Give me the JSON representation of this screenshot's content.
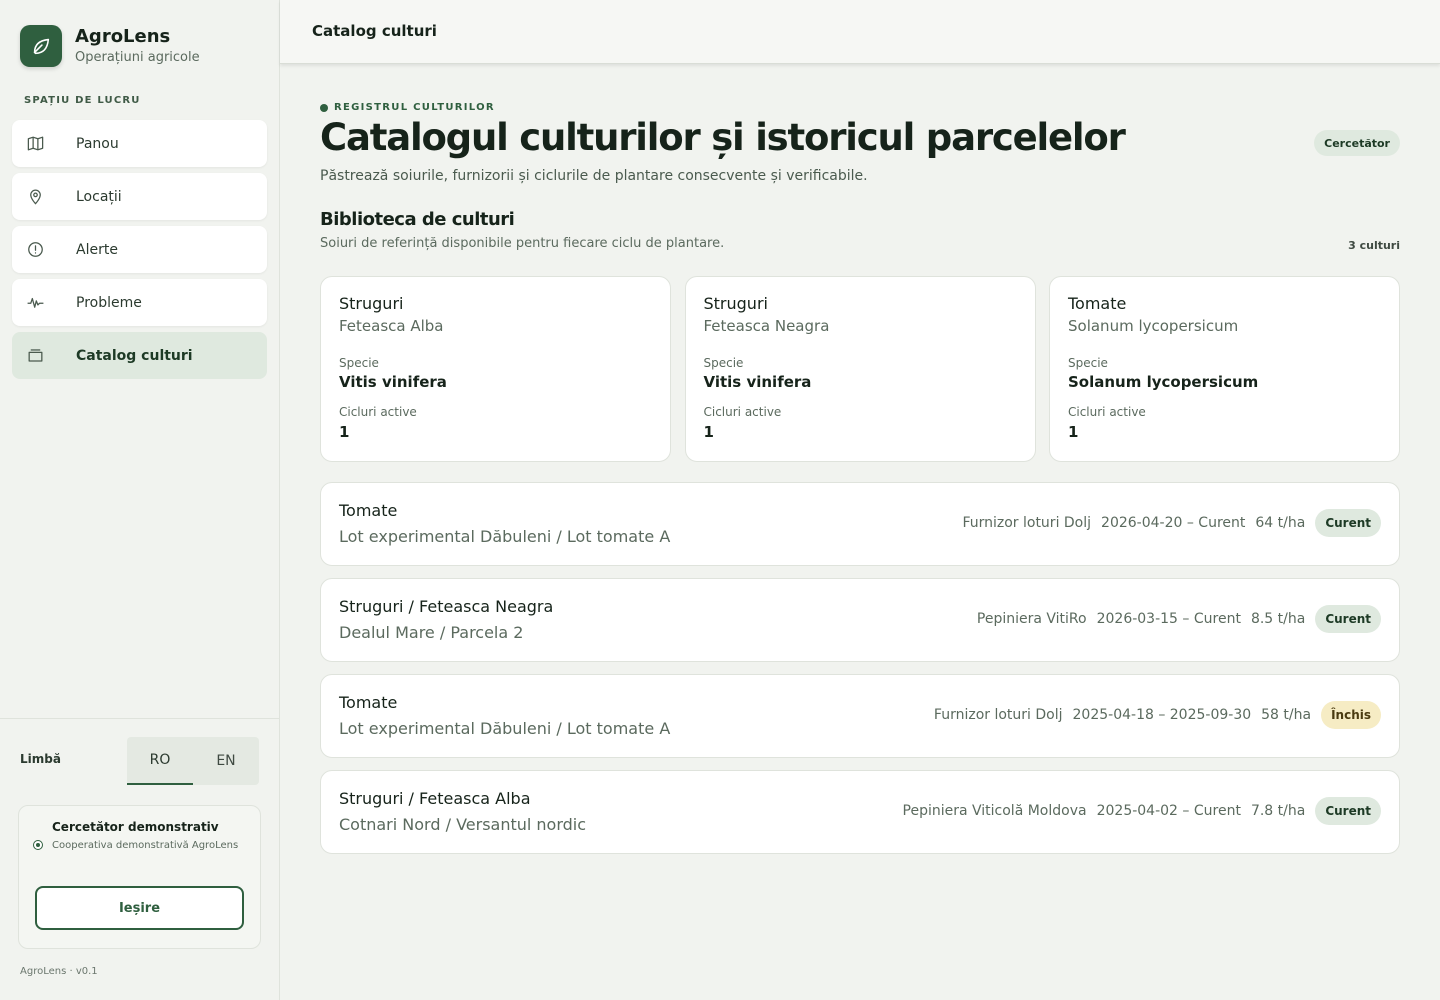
{
  "brand": {
    "name": "AgroLens",
    "subtitle": "Operațiuni agricole"
  },
  "sidebar": {
    "section_label": "SPAȚIU DE LUCRU",
    "items": [
      {
        "label": "Panou",
        "icon": "map-icon"
      },
      {
        "label": "Locații",
        "icon": "location-pin-icon"
      },
      {
        "label": "Alerte",
        "icon": "alert-circle-icon"
      },
      {
        "label": "Probleme",
        "icon": "activity-icon"
      },
      {
        "label": "Catalog culturi",
        "icon": "archive-box-icon",
        "active": true
      }
    ],
    "language": {
      "label": "Limbă",
      "options": [
        "RO",
        "EN"
      ],
      "selected": "RO"
    },
    "user": {
      "name": "Cercetător demonstrativ",
      "org": "Cooperativa demonstrativă AgroLens",
      "logout_label": "Ieșire"
    },
    "version": "AgroLens · v0.1"
  },
  "topbar": {
    "title": "Catalog culturi"
  },
  "header": {
    "eyebrow": "REGISTRUL CULTURILOR",
    "title": "Catalogul culturilor și istoricul parcelelor",
    "subtitle": "Păstrează soiurile, furnizorii și ciclurile de plantare consecvente și verificabile.",
    "role_badge": "Cercetător"
  },
  "library": {
    "title": "Biblioteca de culturi",
    "subtitle": "Soiuri de referință disponibile pentru fiecare ciclu de plantare.",
    "count": "3 culturi",
    "species_label": "Specie",
    "cycles_label": "Cicluri active",
    "crops": [
      {
        "name": "Struguri",
        "variety": "Feteasca Alba",
        "species": "Vitis vinifera",
        "active_cycles": "1"
      },
      {
        "name": "Struguri",
        "variety": "Feteasca Neagra",
        "species": "Vitis vinifera",
        "active_cycles": "1"
      },
      {
        "name": "Tomate",
        "variety": "Solanum lycopersicum",
        "species": "Solanum lycopersicum",
        "active_cycles": "1"
      }
    ]
  },
  "cycles": [
    {
      "title": "Tomate",
      "location": "Lot experimental Dăbuleni / Lot tomate A",
      "supplier": "Furnizor loturi Dolj",
      "period": "2026-04-20 – Curent",
      "yield": "64 t/ha",
      "status": "Curent",
      "status_color": "#dfe9df"
    },
    {
      "title": "Struguri / Feteasca Neagra",
      "location": "Dealul Mare / Parcela 2",
      "supplier": "Pepiniera VitiRo",
      "period": "2026-03-15 – Curent",
      "yield": "8.5 t/ha",
      "status": "Curent",
      "status_color": "#dfe9df"
    },
    {
      "title": "Tomate",
      "location": "Lot experimental Dăbuleni / Lot tomate A",
      "supplier": "Furnizor loturi Dolj",
      "period": "2025-04-18 – 2025-09-30",
      "yield": "58 t/ha",
      "status": "Închis",
      "status_color": "#f6ecc4"
    },
    {
      "title": "Struguri / Feteasca Alba",
      "location": "Cotnari Nord / Versantul nordic",
      "supplier": "Pepiniera Viticolă Moldova",
      "period": "2025-04-02 – Curent",
      "yield": "7.8 t/ha",
      "status": "Curent",
      "status_color": "#dfe9df"
    }
  ],
  "colors": {
    "brand": "#2f5f3f",
    "background": "#f1f3ef",
    "active_nav": "#dfe9df"
  }
}
